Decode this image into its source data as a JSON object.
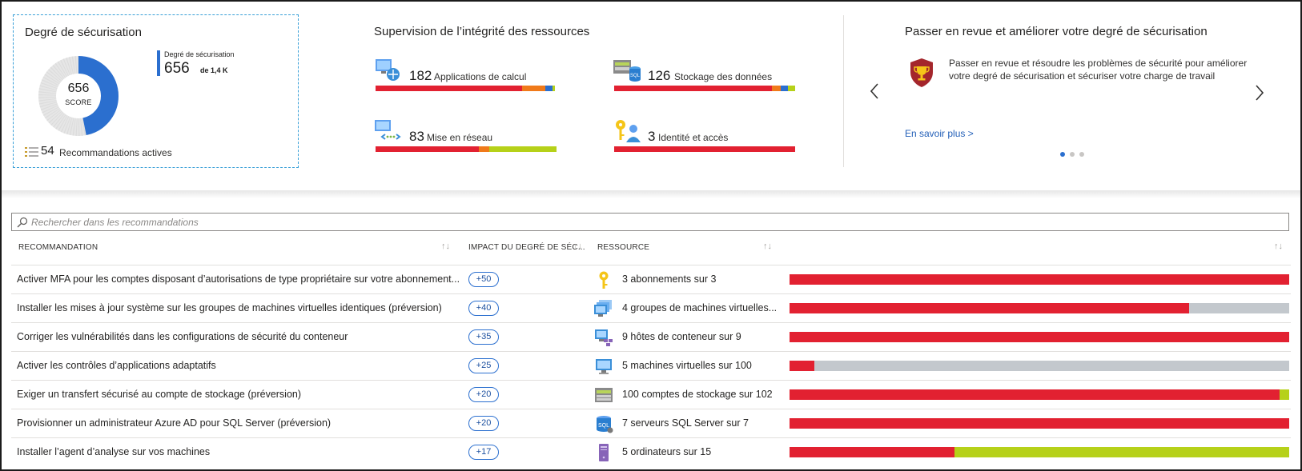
{
  "colors": {
    "red": "#e22131",
    "orange": "#f07a1a",
    "blue": "#2b6fcf",
    "green": "#b6d119",
    "gray": "#c3c8cd",
    "teal": "#2aa6b8"
  },
  "score_card": {
    "title": "Degré de sécurisation",
    "score": "656",
    "score_label": "SCORE",
    "legend_label": "Degré de sécurisation",
    "legend_value": "656",
    "legend_of": "de 1,4 K",
    "score_fraction": 0.468,
    "rec_count": "54",
    "rec_label": "Recommandations actives"
  },
  "resources": {
    "title": "Supervision de l’intégrité des ressources",
    "items": [
      {
        "icon": "compute-icon",
        "count": "182",
        "label": "Applications de calcul",
        "segments": [
          {
            "color": "red",
            "pct": 81
          },
          {
            "color": "orange",
            "pct": 13
          },
          {
            "color": "blue",
            "pct": 4
          },
          {
            "color": "green",
            "pct": 1
          }
        ]
      },
      {
        "icon": "storage-sql-icon",
        "count": "126",
        "label": "Stockage des données",
        "segments": [
          {
            "color": "red",
            "pct": 87
          },
          {
            "color": "orange",
            "pct": 5
          },
          {
            "color": "blue",
            "pct": 4
          },
          {
            "color": "green",
            "pct": 4
          }
        ]
      },
      {
        "icon": "network-icon",
        "count": "83",
        "label": "Mise en réseau",
        "segments": [
          {
            "color": "red",
            "pct": 57
          },
          {
            "color": "orange",
            "pct": 6
          },
          {
            "color": "green",
            "pct": 37
          }
        ]
      },
      {
        "icon": "identity-icon",
        "count": "3",
        "label": "Identité et accès",
        "segments": [
          {
            "color": "red",
            "pct": 100
          }
        ]
      }
    ]
  },
  "carousel": {
    "title": "Passer en revue et améliorer votre degré de sécurisation",
    "text": "Passer en revue et résoudre les problèmes de sécurité pour améliorer votre degré de sécurisation et sécuriser votre charge de travail",
    "link": "En savoir plus  >",
    "active_dot": 0
  },
  "search": {
    "placeholder": "Rechercher dans les recommandations"
  },
  "table": {
    "headers": {
      "recommendation": "RECOMMANDATION",
      "impact": "IMPACT DU DEGRÉ DE SÉC...",
      "resource": "RESSOURCE"
    },
    "rows": [
      {
        "recommendation": "Activer MFA pour les comptes disposant d’autorisations de type propriétaire sur votre abonnement...",
        "impact": "+50",
        "icon": "key-icon",
        "resource": "3 abonnements sur 3",
        "segments": [
          {
            "color": "red",
            "pct": 100
          }
        ]
      },
      {
        "recommendation": "Installer les mises à jour système sur les groupes de machines virtuelles identiques (préversion)",
        "impact": "+40",
        "icon": "vm-scale-set-icon",
        "resource": "4 groupes de machines virtuelles...",
        "segments": [
          {
            "color": "red",
            "pct": 80
          },
          {
            "color": "gray",
            "pct": 20
          }
        ]
      },
      {
        "recommendation": "Corriger les vulnérabilités dans les configurations de sécurité du conteneur",
        "impact": "+35",
        "icon": "container-host-icon",
        "resource": "9 hôtes de conteneur sur 9",
        "segments": [
          {
            "color": "red",
            "pct": 100
          }
        ]
      },
      {
        "recommendation": "Activer les contrôles d’applications adaptatifs",
        "impact": "+25",
        "icon": "vm-icon",
        "resource": "5 machines virtuelles sur 100",
        "segments": [
          {
            "color": "red",
            "pct": 5
          },
          {
            "color": "gray",
            "pct": 95
          }
        ]
      },
      {
        "recommendation": "Exiger un transfert sécurisé au compte de stockage (préversion)",
        "impact": "+20",
        "icon": "storage-account-icon",
        "resource": "100 comptes de stockage sur 102",
        "segments": [
          {
            "color": "red",
            "pct": 98
          },
          {
            "color": "green",
            "pct": 2
          }
        ]
      },
      {
        "recommendation": "Provisionner un administrateur Azure AD pour SQL Server (préversion)",
        "impact": "+20",
        "icon": "sql-server-icon",
        "resource": "7 serveurs SQL Server sur 7",
        "segments": [
          {
            "color": "red",
            "pct": 100
          }
        ]
      },
      {
        "recommendation": "Installer l’agent d’analyse sur vos machines",
        "impact": "+17",
        "icon": "computer-icon",
        "resource": "5 ordinateurs sur 15",
        "segments": [
          {
            "color": "red",
            "pct": 33
          },
          {
            "color": "green",
            "pct": 67
          }
        ]
      }
    ]
  }
}
